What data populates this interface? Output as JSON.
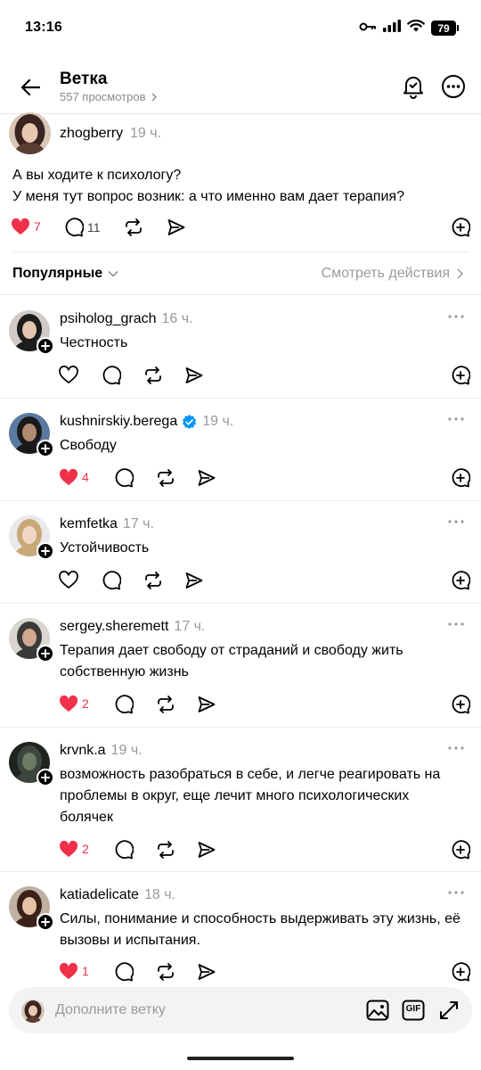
{
  "status_bar": {
    "time": "13:16",
    "battery": "79"
  },
  "header": {
    "title": "Ветка",
    "views": "557 просмотров"
  },
  "root_post": {
    "username": "zhogberry",
    "time": "19 ч.",
    "text_line1": "А вы ходите к психологу?",
    "text_line2": "У меня тут вопрос возник: а что именно вам дает терапия?",
    "likes": "7",
    "replies": "11"
  },
  "sort_bar": {
    "sort_label": "Популярные",
    "view_activity": "Смотреть действия"
  },
  "replies": [
    {
      "username": "psiholog_grach",
      "time": "16 ч.",
      "text": "Честность",
      "likes": "",
      "liked": false,
      "verified": false
    },
    {
      "username": "kushnirskiy.berega",
      "time": "19 ч.",
      "text": "Свободу",
      "likes": "4",
      "liked": true,
      "verified": true
    },
    {
      "username": "kemfetka",
      "time": "17 ч.",
      "text": "Устойчивость",
      "likes": "",
      "liked": false,
      "verified": false
    },
    {
      "username": "sergey.sheremett",
      "time": "17 ч.",
      "text": "Терапия дает свободу от страданий и свободу жить собственную жизнь",
      "likes": "2",
      "liked": true,
      "verified": false
    },
    {
      "username": "krvnk.a",
      "time": "19 ч.",
      "text": "возможность разобраться в себе, и легче реагировать на проблемы в округ, еще лечит много психологических болячек",
      "likes": "2",
      "liked": true,
      "verified": false
    },
    {
      "username": "katiadelicate",
      "time": "18 ч.",
      "text": "Силы, понимание и способность выдерживать эту жизнь, её вызовы и испытания.",
      "likes": "1",
      "liked": true,
      "verified": false
    }
  ],
  "composer": {
    "placeholder": "Дополните ветку",
    "gif_label": "GIF"
  },
  "colors": {
    "like_red": "#f0304a",
    "verified_blue": "#0095f6",
    "muted": "#999999"
  },
  "icons": [
    "back-arrow-icon",
    "bell-check-icon",
    "more-circle-icon",
    "heart-icon",
    "comment-icon",
    "repost-icon",
    "share-icon",
    "quote-add-icon",
    "chevron-down-icon",
    "chevron-right-icon",
    "ellipsis-icon",
    "plus-icon",
    "image-icon",
    "gif-icon",
    "expand-icon",
    "verified-badge-icon",
    "key-icon",
    "signal-icon",
    "wifi-icon"
  ]
}
